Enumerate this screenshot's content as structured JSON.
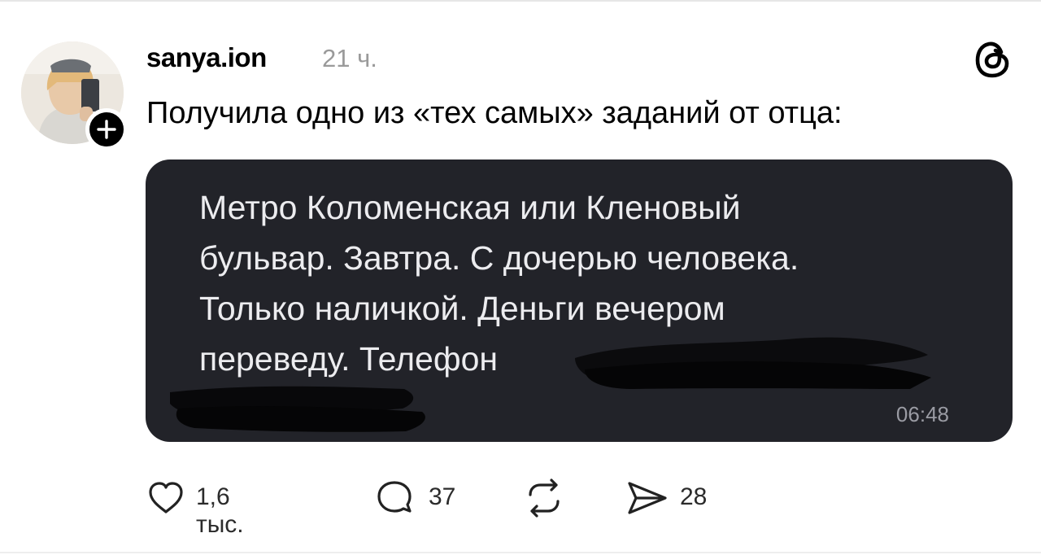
{
  "post": {
    "username": "sanya.ion",
    "time": "21 ч.",
    "text": "Получила одно из «тех самых» заданий от отца:"
  },
  "message": {
    "lines": [
      "Метро Коломенская или Кленовый",
      "бульвар. Завтра. С дочерью человека.",
      "Только наличкой. Деньги вечером",
      "переведу. Телефон"
    ],
    "time": "06:48"
  },
  "actions": {
    "likes": "1,6 тыс.",
    "replies": "37",
    "shares": "28"
  },
  "icons": {
    "follow": "plus-icon",
    "app": "threads-logo-icon",
    "like": "heart-icon",
    "reply": "speech-bubble-icon",
    "repost": "repost-icon",
    "share": "send-icon"
  }
}
